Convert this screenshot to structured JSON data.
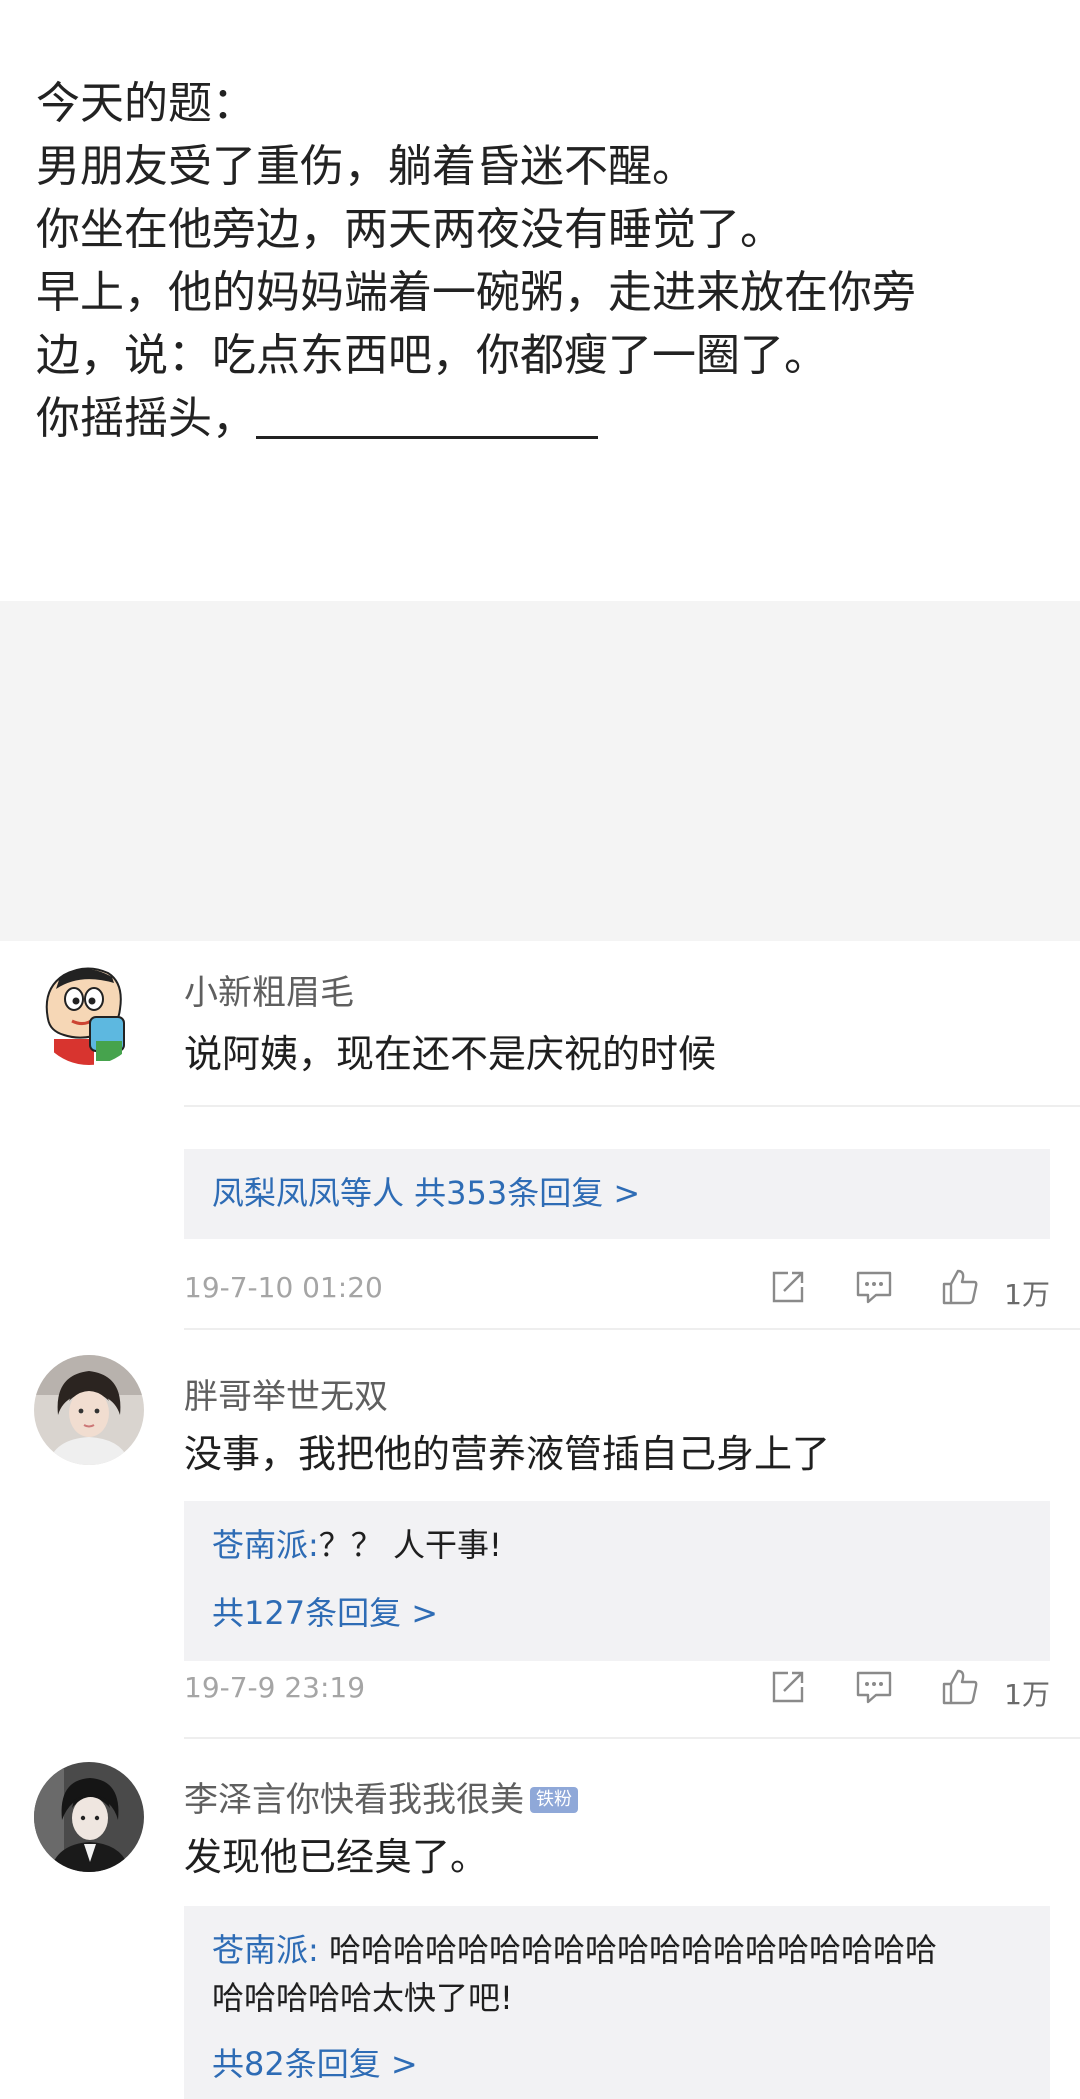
{
  "question": {
    "lines": [
      "今天的题：",
      "男朋友受了重伤，躺着昏迷不醒。",
      "你坐在他旁边，两天两夜没有睡觉了。",
      "早上，他的妈妈端着一碗粥，走进来放在你旁",
      "边，说：吃点东西吧，你都瘦了一圈了。",
      "你摇摇头，"
    ]
  },
  "comments": [
    {
      "username": "小新粗眉毛",
      "text": "说阿姨，现在还不是庆祝的时候",
      "reply_summary": "凤梨凤凤等人  共353条回复 >",
      "timestamp": "19-7-10 01:20",
      "likes": "1万"
    },
    {
      "username": "胖哥举世无双",
      "text": "没事，我把他的营养液管插自己身上了",
      "reply_user": "苍南派:",
      "reply_text": "？？ 人干事!",
      "reply_count": "共127条回复 >",
      "timestamp": "19-7-9 23:19",
      "likes": "1万"
    },
    {
      "username": "李泽言你快看我我很美",
      "badge": "铁粉",
      "text": "发现他已经臭了。",
      "reply_user": "苍南派:",
      "reply_text_1": " 哈哈哈哈哈哈哈哈哈哈哈哈哈哈哈哈哈哈哈",
      "reply_text_2": "哈哈哈哈哈太快了吧!",
      "reply_count": "共82条回复 >"
    }
  ],
  "colors": {
    "link_blue": "#2e6cb5",
    "reply_bg": "#f2f2f4",
    "badge_bg": "#8fa8d8"
  },
  "icons": [
    "share-icon",
    "comment-icon",
    "like-icon"
  ]
}
